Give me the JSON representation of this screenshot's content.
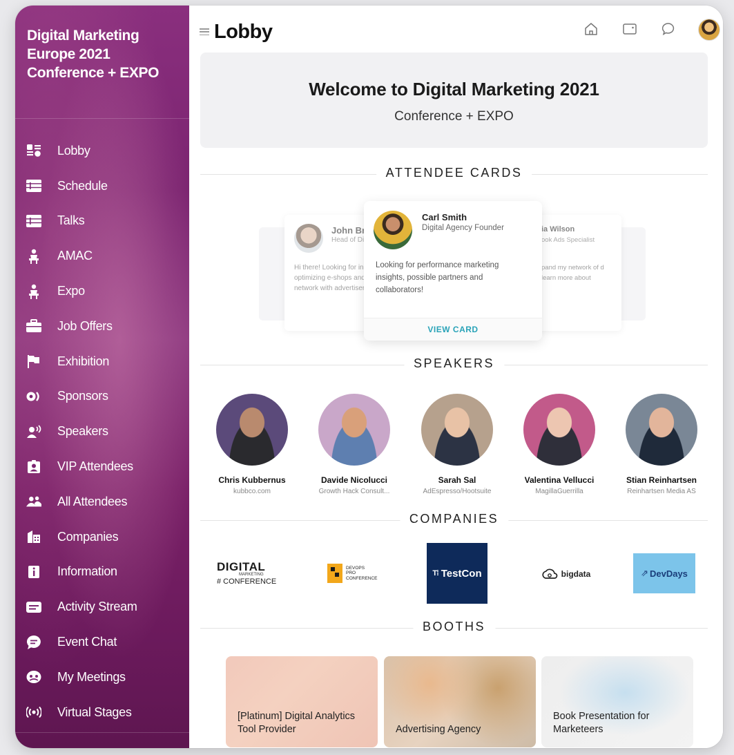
{
  "sidebar": {
    "event_title": "Digital Marketing Europe 2021 Conference + EXPO",
    "items": [
      {
        "label": "Lobby",
        "icon": "lobby-icon"
      },
      {
        "label": "Schedule",
        "icon": "list-icon"
      },
      {
        "label": "Talks",
        "icon": "list-icon"
      },
      {
        "label": "AMAC",
        "icon": "podium-icon"
      },
      {
        "label": "Expo",
        "icon": "podium-icon"
      },
      {
        "label": "Job Offers",
        "icon": "briefcase-icon"
      },
      {
        "label": "Exhibition",
        "icon": "flag-icon"
      },
      {
        "label": "Sponsors",
        "icon": "sponsors-icon"
      },
      {
        "label": "Speakers",
        "icon": "speaker-icon"
      },
      {
        "label": "VIP Attendees",
        "icon": "vip-badge-icon"
      },
      {
        "label": "All Attendees",
        "icon": "people-icon"
      },
      {
        "label": "Companies",
        "icon": "building-icon"
      },
      {
        "label": "Information",
        "icon": "info-icon"
      },
      {
        "label": "Activity Stream",
        "icon": "stream-icon"
      },
      {
        "label": "Event Chat",
        "icon": "chat-icon"
      },
      {
        "label": "My Meetings",
        "icon": "meetings-icon"
      },
      {
        "label": "Virtual Stages",
        "icon": "broadcast-icon"
      }
    ]
  },
  "header": {
    "title": "Lobby",
    "icons": [
      "home-icon",
      "wallet-icon",
      "chat-bubble-icon",
      "user-avatar"
    ]
  },
  "welcome": {
    "title": "Welcome to Digital Marketing 2021",
    "subtitle": "Conference + EXPO"
  },
  "sections": {
    "attendee_cards": "ATTENDEE CARDS",
    "speakers": "SPEAKERS",
    "companies": "COMPANIES",
    "booths": "BOOTHS"
  },
  "attendee_cards": {
    "left": {
      "name": "John Brov",
      "role": "Head of Dig",
      "text": "Hi there! Looking for insi optimizing e-shops and t network with advertiser"
    },
    "center": {
      "name": "Carl Smith",
      "role": "Digital Agency Founder",
      "text": "Looking for performance marketing insights, possible partners and collaborators!",
      "action": "VIEW CARD"
    },
    "right": {
      "name": "ia Wilson",
      "role": "ook Ads Specialist",
      "text": "pand my network of d learn more about"
    }
  },
  "speakers": [
    {
      "name": "Chris Kubbernus",
      "org": "kubbco.com",
      "tone": "#2a2a2e",
      "skin": "#b98a6e",
      "bg": "#5b4a7a"
    },
    {
      "name": "Davide Nicolucci",
      "org": "Growth Hack Consult...",
      "tone": "#5e7fb0",
      "skin": "#d9a07a",
      "bg": "#c9a7c9"
    },
    {
      "name": "Sarah Sal",
      "org": "AdEspresso/Hootsuite",
      "tone": "#2c3344",
      "skin": "#e8c2a6",
      "bg": "#b6a18d"
    },
    {
      "name": "Valentina Vellucci",
      "org": "MagillaGuerrilla",
      "tone": "#2f2f3a",
      "skin": "#edc6b1",
      "bg": "#c25a8a"
    },
    {
      "name": "Stian Reinhartsen",
      "org": "Reinhartsen Media AS",
      "tone": "#1f2a3a",
      "skin": "#e2b59b",
      "bg": "#7a8796"
    }
  ],
  "companies": [
    {
      "name": "DIGITAL MARKETING # CONFERENCE",
      "line1": "DIGITAL",
      "line2": "MARKETING",
      "line3": "# CONFERENCE"
    },
    {
      "name": "DEVOPS PRO CONFERENCE",
      "line1": "DEVOPS",
      "line2": "PRO",
      "line3": "CONFERENCE"
    },
    {
      "name": "TestCon",
      "label": "TestCon",
      "bg": "#0e2a5a"
    },
    {
      "name": "bigdata",
      "label": "bigdata"
    },
    {
      "name": "DevDays",
      "label": "DevDays",
      "bg": "#7cc4ea"
    }
  ],
  "booths": [
    {
      "label": "[Platinum] Digital Analytics Tool Provider"
    },
    {
      "label": "Advertising Agency"
    },
    {
      "label": "Book Presentation for Marketeers"
    }
  ]
}
